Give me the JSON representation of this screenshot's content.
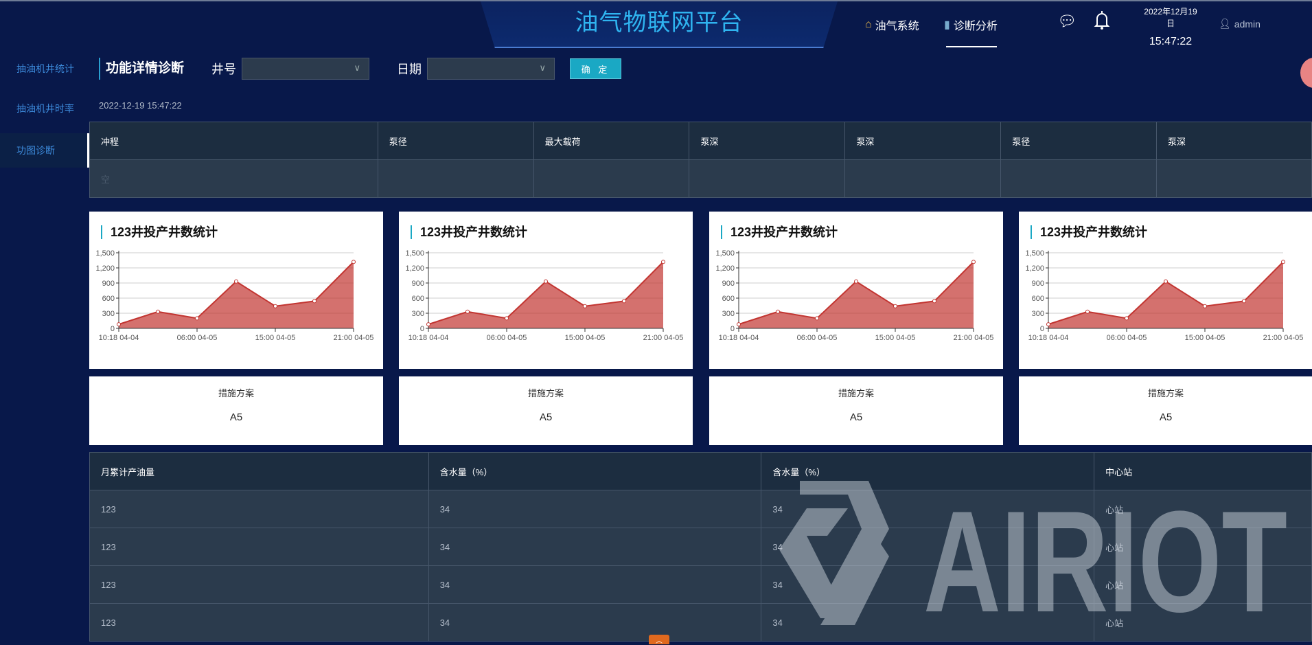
{
  "header": {
    "title": "油气物联网平台",
    "nav": [
      {
        "label": "油气系统",
        "icon": "home-icon"
      },
      {
        "label": "诊断分析",
        "icon": "bar-chart-icon",
        "active": true
      }
    ],
    "date": "2022年12月19日",
    "time": "15:47:22",
    "user": "admin"
  },
  "sidebar": {
    "items": [
      {
        "label": "抽油机井统计"
      },
      {
        "label": "抽油机井时率"
      },
      {
        "label": "功图诊断",
        "active": true
      }
    ]
  },
  "toolbar": {
    "title": "功能详情诊断",
    "well_label": "井号",
    "well_value": "",
    "date_label": "日期",
    "date_value": "",
    "confirm": "确 定"
  },
  "timestamp": "2022-12-19 15:47:22",
  "table1": {
    "headers": [
      "冲程",
      "泵径",
      "最大载荷",
      "泵深",
      "泵深",
      "泵径",
      "泵深"
    ],
    "empty_text": "空"
  },
  "charts": [
    {
      "title": "123井投产井数统计"
    },
    {
      "title": "123井投产井数统计"
    },
    {
      "title": "123井投产井数统计"
    },
    {
      "title": "123井投产井数统计"
    }
  ],
  "chart_data": {
    "type": "area",
    "x_labels": [
      "10:18 04-04",
      "",
      "06:00 04-05",
      "",
      "15:00 04-05",
      "",
      "21:00 04-05"
    ],
    "values": [
      80,
      330,
      200,
      930,
      440,
      540,
      1320
    ],
    "ylim": [
      0,
      1500
    ],
    "yticks": [
      "0",
      "300",
      "600",
      "900",
      "1,200",
      "1,500"
    ],
    "color": "#c23531"
  },
  "plans": [
    {
      "label": "措施方案",
      "value": "A5"
    },
    {
      "label": "措施方案",
      "value": "A5"
    },
    {
      "label": "措施方案",
      "value": "A5"
    },
    {
      "label": "措施方案",
      "value": "A5"
    }
  ],
  "table2": {
    "headers": [
      "月累计产油量",
      "含水量（%）",
      "含水量（%）",
      "中心站"
    ],
    "rows": [
      [
        "123",
        "34",
        "34",
        "心站"
      ],
      [
        "123",
        "34",
        "34",
        "心站"
      ],
      [
        "123",
        "34",
        "34",
        "心站"
      ],
      [
        "123",
        "34",
        "34",
        "心站"
      ]
    ]
  },
  "watermark": "AIRIOT"
}
